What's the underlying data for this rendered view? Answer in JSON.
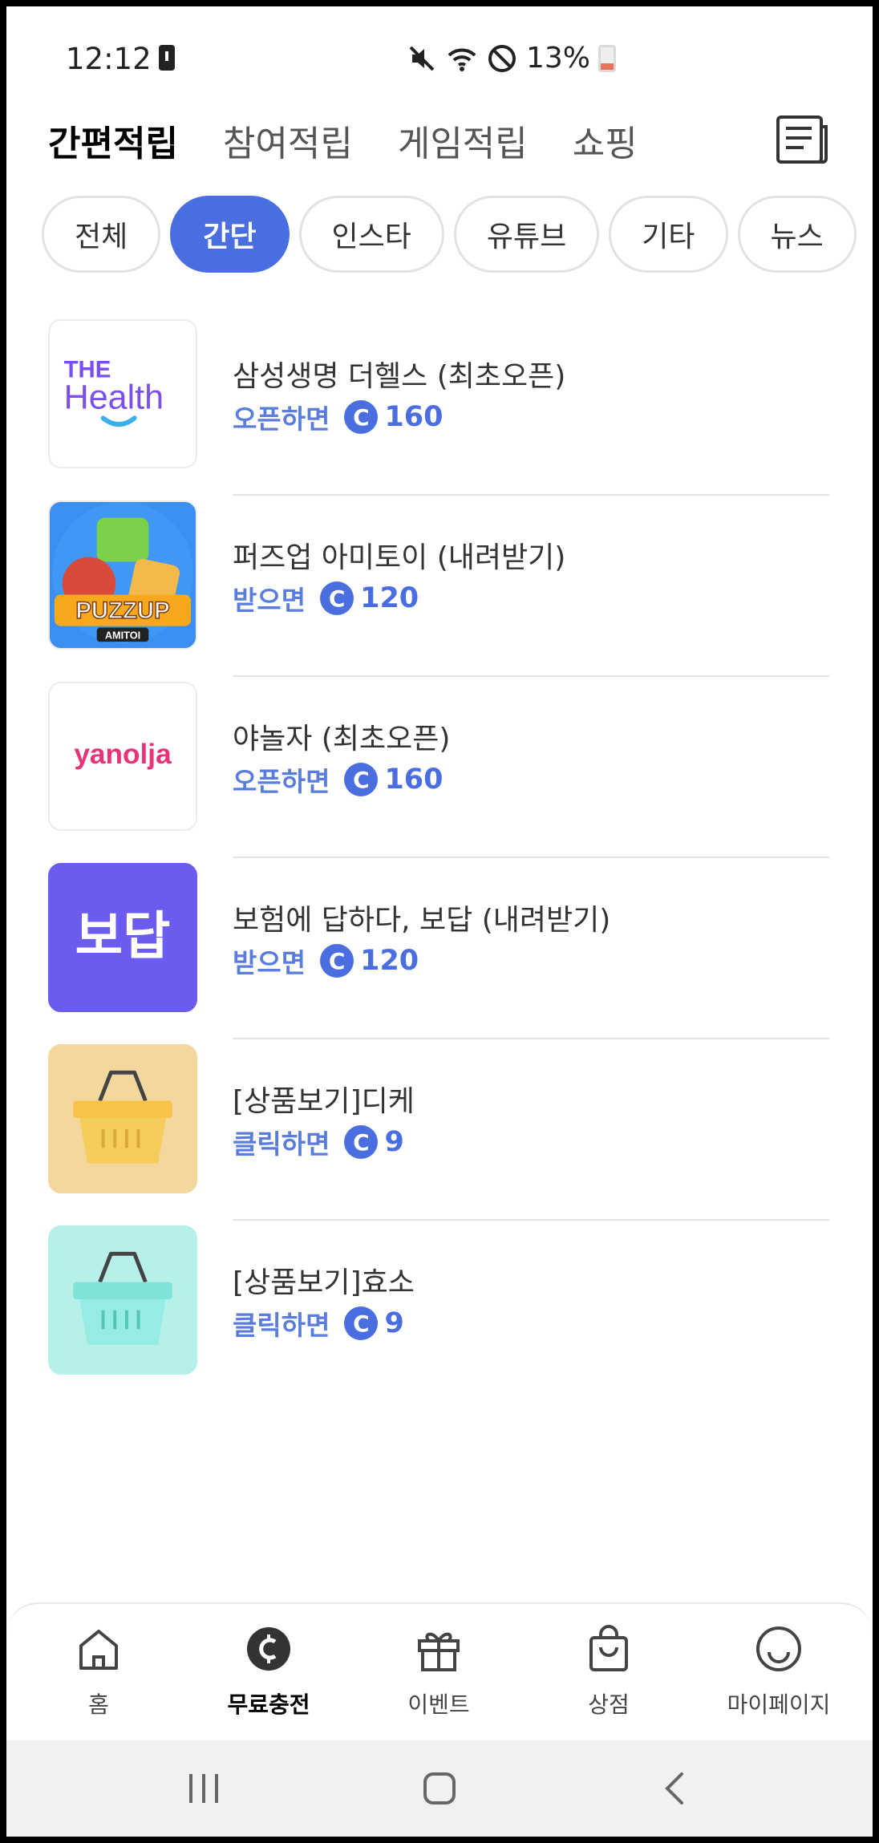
{
  "status_bar": {
    "time": "12:12",
    "battery": "13%",
    "icons": [
      "battery-alert-icon",
      "mute-icon",
      "wifi-icon",
      "do-not-disturb-icon",
      "battery-icon"
    ]
  },
  "top_tabs": [
    {
      "label": "간편적립",
      "active": true
    },
    {
      "label": "참여적립",
      "active": false
    },
    {
      "label": "게임적립",
      "active": false
    },
    {
      "label": "쇼핑",
      "active": false
    }
  ],
  "chips": [
    {
      "label": "전체",
      "active": false
    },
    {
      "label": "간단",
      "active": true
    },
    {
      "label": "인스타",
      "active": false
    },
    {
      "label": "유튜브",
      "active": false
    },
    {
      "label": "기타",
      "active": false
    },
    {
      "label": "뉴스",
      "active": false
    }
  ],
  "items": [
    {
      "title": "삼성생명 더헬스 (최초오픈)",
      "reward_label": "오픈하면",
      "coin": "C",
      "reward": "160",
      "logo_top": "THE",
      "logo_main": "Health"
    },
    {
      "title": "퍼즈업 아미토이 (내려받기)",
      "reward_label": "받으면",
      "coin": "C",
      "reward": "120",
      "logo_main": "PUZZUP",
      "logo_sub": "AMITOI"
    },
    {
      "title": "야놀자 (최초오픈)",
      "reward_label": "오픈하면",
      "coin": "C",
      "reward": "160",
      "logo_main": "yanolja"
    },
    {
      "title": "보험에 답하다, 보답 (내려받기)",
      "reward_label": "받으면",
      "coin": "C",
      "reward": "120",
      "logo_main": "보답"
    },
    {
      "title": "[상품보기]디케",
      "reward_label": "클릭하면",
      "coin": "C",
      "reward": "9"
    },
    {
      "title": "[상품보기]효소",
      "reward_label": "클릭하면",
      "coin": "C",
      "reward": "9"
    }
  ],
  "bottom_nav": [
    {
      "label": "홈",
      "icon": "home-icon",
      "active": false
    },
    {
      "label": "무료충전",
      "icon": "coin-icon",
      "active": true
    },
    {
      "label": "이벤트",
      "icon": "gift-icon",
      "active": false
    },
    {
      "label": "상점",
      "icon": "shopping-bag-icon",
      "active": false
    },
    {
      "label": "마이페이지",
      "icon": "smiley-icon",
      "active": false
    }
  ],
  "colors": {
    "accent": "#4a6ee0",
    "reward_label": "#5a7ddd",
    "bodap_bg": "#6b5cf0",
    "basket_yellow_bg": "#f3d79e",
    "basket_mint_bg": "#b6f0e8"
  }
}
